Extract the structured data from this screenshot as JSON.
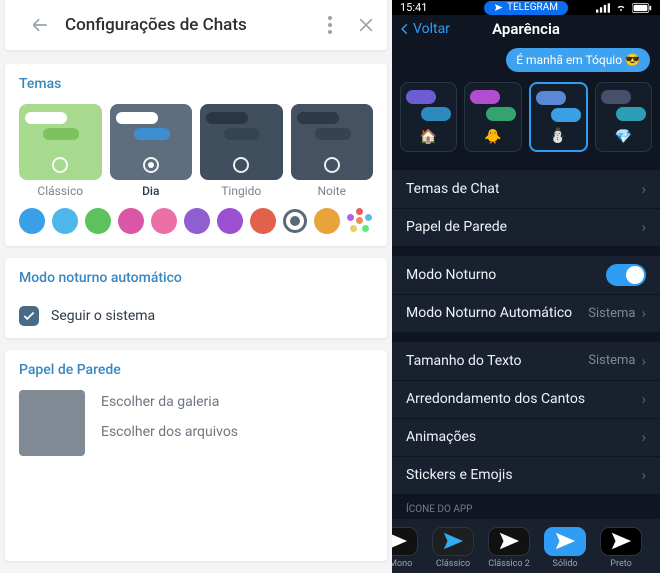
{
  "left": {
    "header_title": "Configurações de Chats",
    "themes_title": "Temas",
    "themes": [
      {
        "name": "Clássico",
        "bg": "#a7d98e",
        "b1": "#ffffff",
        "b2": "#7dc25f",
        "selected": false
      },
      {
        "name": "Dia",
        "bg": "#5e6e7e",
        "b1": "#ffffff",
        "b2": "#3e8fd0",
        "selected": true
      },
      {
        "name": "Tingido",
        "bg": "#3f4f5e",
        "b1": "#2a3643",
        "b2": "#344452",
        "selected": false
      },
      {
        "name": "Noite",
        "bg": "#455261",
        "b1": "#2d3946",
        "b2": "#35424f",
        "selected": false
      }
    ],
    "colors": [
      "#39a0e8",
      "#4cb7e8",
      "#5bc25e",
      "#d957a6",
      "#eb6fa5",
      "#8f5fd1",
      "#9b4fd1",
      "#e2614a",
      "#ring",
      "#e8a43b",
      "#multi"
    ],
    "night_title": "Modo noturno automático",
    "night_follow": "Seguir o sistema",
    "wall_title": "Papel de Parede",
    "wall_gallery": "Escolher da galeria",
    "wall_files": "Escolher dos arquivos"
  },
  "right": {
    "status_time": "15:41",
    "status_pill": "TELEGRAM",
    "nav_back": "Voltar",
    "nav_title": "Aparência",
    "preview_msg": "É manhã em Tóquio 😎",
    "chat_themes": [
      {
        "c1": "#6c5dd3",
        "c2": "#2c8abf",
        "emoji": "🏠",
        "selected": false
      },
      {
        "c1": "#b24dd1",
        "c2": "#34a36f",
        "emoji": "🐥",
        "selected": false
      },
      {
        "c1": "#5b88d6",
        "c2": "#3aa0e6",
        "emoji": "⛄",
        "selected": true
      },
      {
        "c1": "#47506a",
        "c2": "#2c9fb5",
        "emoji": "💎",
        "selected": false
      }
    ],
    "rows1": [
      {
        "label": "Temas de Chat"
      },
      {
        "label": "Papel de Parede"
      }
    ],
    "rows2": [
      {
        "label": "Modo Noturno",
        "toggle": true
      },
      {
        "label": "Modo Noturno Automático",
        "value": "Sistema"
      }
    ],
    "rows3": [
      {
        "label": "Tamanho do Texto",
        "value": "Sistema"
      },
      {
        "label": "Arredondamento dos Cantos"
      },
      {
        "label": "Animações"
      },
      {
        "label": "Stickers e Emojis"
      }
    ],
    "appicon_caption": "Ícone do App",
    "appicons": [
      {
        "label": "o Mono",
        "bg": "#111111",
        "plane": "#ffffff",
        "selected": false,
        "partial": "left"
      },
      {
        "label": "Clássico",
        "bg": "#1d1f21",
        "plane": "#33aaf0",
        "selected": false
      },
      {
        "label": "Clássico 2",
        "bg": "#111111",
        "plane": "#ffffff",
        "selected": false
      },
      {
        "label": "Sólido",
        "bg": "#2f9df4",
        "plane": "#ffffff",
        "selected": true
      },
      {
        "label": "Preto",
        "bg": "#000000",
        "plane": "#ffffff",
        "selected": false,
        "partial": "right"
      }
    ]
  }
}
